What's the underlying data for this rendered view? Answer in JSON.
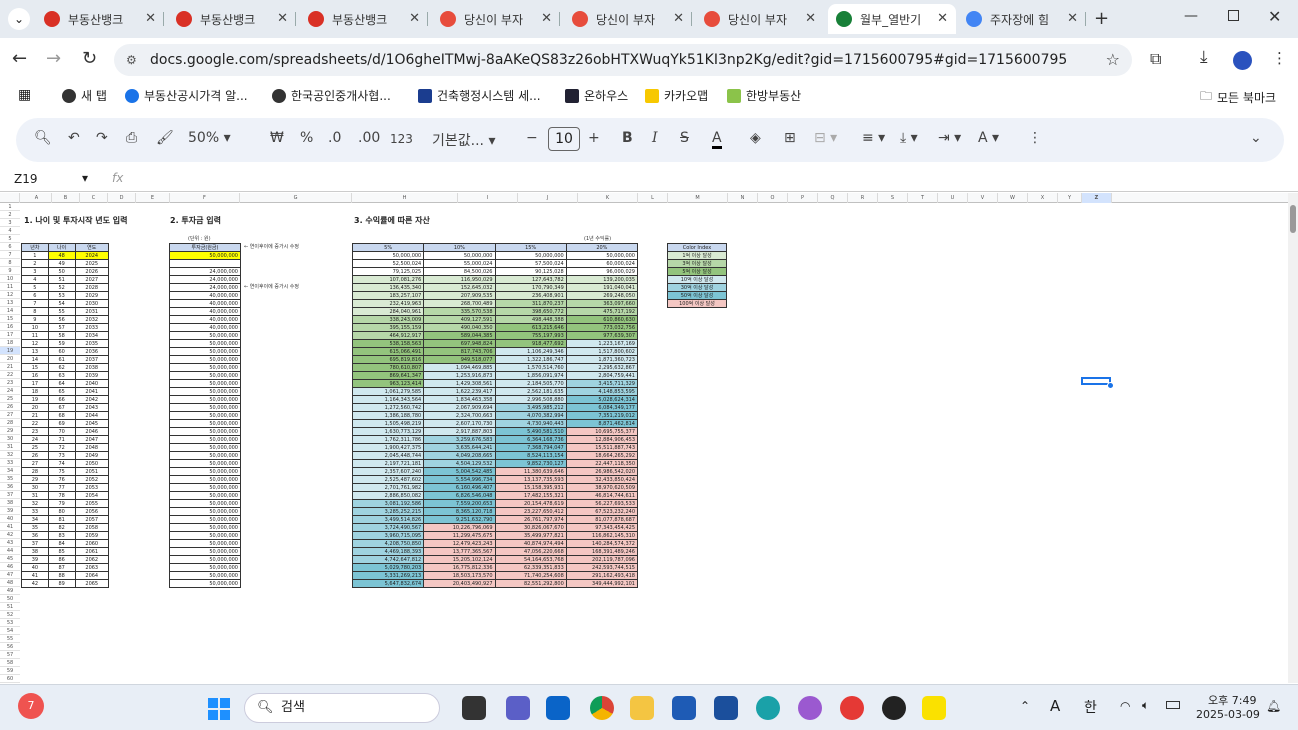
{
  "tabs": [
    {
      "title": "부동산뱅크",
      "color": "#d93025"
    },
    {
      "title": "부동산뱅크",
      "color": "#d93025"
    },
    {
      "title": "부동산뱅크",
      "color": "#d93025"
    },
    {
      "title": "당신이 부자",
      "color": "#e74c3c"
    },
    {
      "title": "당신이 부자",
      "color": "#e74c3c"
    },
    {
      "title": "당신이 부자",
      "color": "#e74c3c"
    },
    {
      "title": "월부_열반기",
      "color": "#188038"
    },
    {
      "title": "주자장에 힘",
      "color": "#4285f4"
    }
  ],
  "address": "docs.google.com/spreadsheets/d/1O6gheITMwj-8aAKeQS83z26obHTXWuqYk51KI3np2Kg/edit?gid=1715600795#gid=1715600795",
  "bookmarks": [
    "새 탭",
    "부동산공시가격 알...",
    "한국공인중개사협...",
    "건축행정시스템 세...",
    "온하우스",
    "카카오맵",
    "한방부동산"
  ],
  "all_bookmarks": "모든 북마크",
  "toolbar": {
    "zoom": "50%",
    "currency": "₩",
    "percent": "%",
    "dec_minus": ".0",
    "dec_plus": ".00",
    "num_format": "123",
    "font": "기본값...",
    "font_size": "10"
  },
  "cell_ref": "Z19",
  "fx": "fx",
  "columns": [
    "A",
    "B",
    "C",
    "D",
    "E",
    "F",
    "G",
    "H",
    "I",
    "J",
    "K",
    "L",
    "M",
    "N",
    "O",
    "P",
    "Q",
    "R",
    "S",
    "T",
    "U",
    "V",
    "W",
    "X",
    "Y",
    "Z"
  ],
  "sections": {
    "s1": "1. 나이 및 투자시작 년도 입력",
    "s2": "2. 투자금 입력",
    "s3": "3. 수익률에 따른 자산"
  },
  "unit_note": "(단위 : 원)",
  "return_note": "(1년 수익률)",
  "t1_headers": [
    "년차",
    "나이",
    "연도"
  ],
  "t2_header": "투자금(원금)",
  "t3_headers": [
    "5%",
    "10%",
    "15%",
    "20%"
  ],
  "notes": [
    {
      "row": 6,
      "text": "← 연이후이에 증가시 수정"
    },
    {
      "row": 11,
      "text": "← 연이후이에 증가시 수정"
    }
  ],
  "color_index": {
    "title": "Color Index",
    "items": [
      "1억 이상 달성",
      "3억 이상 달성",
      "5억 이상 달성",
      "10억 이상 달성",
      "30억 이상 달성",
      "50억 이상 달성",
      "100억 이상 달성"
    ],
    "colors": [
      "#d9ead3",
      "#b6d7a8",
      "#93c47d",
      "#d0e8ee",
      "#9fd3e0",
      "#7cc4d4",
      "#f4c7c3"
    ]
  },
  "invest": [
    "50,000,000",
    "",
    "24,000,000",
    "24,000,000",
    "24,000,000",
    "40,000,000",
    "40,000,000",
    "40,000,000",
    "40,000,000",
    "40,000,000",
    "50,000,000",
    "50,000,000",
    "50,000,000",
    "50,000,000",
    "50,000,000",
    "50,000,000",
    "50,000,000",
    "50,000,000",
    "50,000,000",
    "50,000,000",
    "50,000,000",
    "50,000,000",
    "50,000,000",
    "50,000,000",
    "50,000,000",
    "50,000,000",
    "50,000,000",
    "50,000,000",
    "50,000,000",
    "50,000,000",
    "50,000,000",
    "50,000,000",
    "50,000,000",
    "50,000,000",
    "50,000,000",
    "50,000,000",
    "50,000,000",
    "50,000,000",
    "50,000,000",
    "50,000,000",
    "50,000,000",
    "50,000,000"
  ],
  "assets": [
    [
      "50,000,000",
      "50,000,000",
      "50,000,000",
      "50,000,000"
    ],
    [
      "52,500,024",
      "55,000,024",
      "57,500,024",
      "60,000,024"
    ],
    [
      "79,125,025",
      "84,500,026",
      "90,125,028",
      "96,000,029"
    ],
    [
      "107,081,276",
      "116,950,029",
      "127,643,782",
      "139,200,035"
    ],
    [
      "136,435,340",
      "152,645,032",
      "170,790,349",
      "191,040,041"
    ],
    [
      "183,257,107",
      "207,909,535",
      "236,408,901",
      "269,248,050"
    ],
    [
      "232,419,963",
      "268,700,489",
      "311,870,237",
      "363,097,660"
    ],
    [
      "284,040,961",
      "335,570,538",
      "398,650,772",
      "475,717,192"
    ],
    [
      "338,243,009",
      "409,127,591",
      "498,448,388",
      "610,860,630"
    ],
    [
      "395,155,159",
      "490,040,350",
      "613,215,646",
      "773,032,756"
    ],
    [
      "464,912,917",
      "589,044,385",
      "755,197,993",
      "977,639,307"
    ],
    [
      "538,158,563",
      "697,948,824",
      "918,477,692",
      "1,223,167,169"
    ],
    [
      "615,066,491",
      "817,743,706",
      "1,106,249,346",
      "1,517,800,602"
    ],
    [
      "695,819,816",
      "949,518,077",
      "1,322,186,747",
      "1,871,360,723"
    ],
    [
      "780,610,807",
      "1,094,469,885",
      "1,570,514,760",
      "2,295,632,867"
    ],
    [
      "869,641,347",
      "1,253,916,873",
      "1,856,091,974",
      "2,804,759,441"
    ],
    [
      "963,123,414",
      "1,429,308,561",
      "2,184,505,770",
      "3,415,711,329"
    ],
    [
      "1,061,279,585",
      "1,622,239,417",
      "2,562,181,635",
      "4,148,853,595"
    ],
    [
      "1,164,343,564",
      "1,834,463,358",
      "2,996,508,880",
      "5,028,624,314"
    ],
    [
      "1,272,560,742",
      "2,067,909,694",
      "3,495,985,212",
      "6,084,349,177"
    ],
    [
      "1,386,188,780",
      "2,324,700,663",
      "4,070,382,994",
      "7,351,219,012"
    ],
    [
      "1,505,498,219",
      "2,607,170,730",
      "4,730,940,443",
      "8,871,462,814"
    ],
    [
      "1,630,773,129",
      "2,917,887,803",
      "5,490,581,510",
      "10,695,755,377"
    ],
    [
      "1,762,311,786",
      "3,259,676,583",
      "6,364,168,736",
      "12,884,906,453"
    ],
    [
      "1,900,427,375",
      "3,635,644,241",
      "7,368,794,047",
      "15,511,887,743"
    ],
    [
      "2,045,448,744",
      "4,049,208,665",
      "8,524,113,154",
      "18,664,265,292"
    ],
    [
      "2,197,721,181",
      "4,504,129,532",
      "9,852,730,127",
      "22,447,118,350"
    ],
    [
      "2,357,607,240",
      "5,004,542,485",
      "11,380,639,646",
      "26,986,542,020"
    ],
    [
      "2,525,487,602",
      "5,554,996,734",
      "13,137,735,593",
      "32,433,850,424"
    ],
    [
      "2,701,761,982",
      "6,160,496,407",
      "15,158,395,931",
      "38,970,620,509"
    ],
    [
      "2,886,850,082",
      "6,826,546,048",
      "17,482,155,321",
      "46,814,744,611"
    ],
    [
      "3,081,192,586",
      "7,559,200,653",
      "20,154,478,619",
      "56,227,693,533"
    ],
    [
      "3,285,252,215",
      "8,365,120,718",
      "23,227,650,412",
      "67,523,232,240"
    ],
    [
      "3,499,514,826",
      "9,251,632,790",
      "26,761,797,974",
      "81,077,878,687"
    ],
    [
      "3,724,490,567",
      "10,226,796,069",
      "30,826,067,670",
      "97,343,454,425"
    ],
    [
      "3,960,715,095",
      "11,299,475,675",
      "35,499,977,821",
      "116,862,145,310"
    ],
    [
      "4,208,750,850",
      "12,479,423,243",
      "40,874,974,494",
      "140,284,574,372"
    ],
    [
      "4,469,188,393",
      "13,777,365,567",
      "47,056,220,668",
      "168,391,489,246"
    ],
    [
      "4,742,647,812",
      "15,205,102,124",
      "54,164,653,768",
      "202,119,787,096"
    ],
    [
      "5,029,780,203",
      "16,775,812,336",
      "62,339,351,833",
      "242,593,744,515"
    ],
    [
      "5,331,269,213",
      "18,503,173,570",
      "71,740,254,608",
      "291,162,493,418"
    ],
    [
      "5,647,832,674",
      "20,403,490,927",
      "82,551,292,800",
      "349,444,992,101"
    ]
  ],
  "taskbar": {
    "search": "검색",
    "time": "오후 7:49",
    "date": "2025-03-09",
    "lang1": "A",
    "lang2": "한",
    "badge": "7"
  }
}
